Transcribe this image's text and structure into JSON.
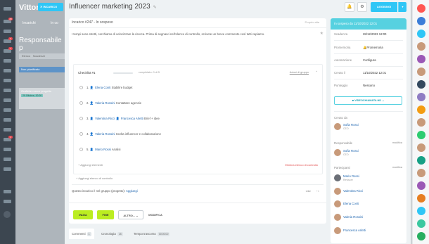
{
  "bg": {
    "brand": "Vittori",
    "tabs": [
      "Incarichi",
      "In co"
    ],
    "title": "Responsabile p",
    "bar_items": [
      "Elenco",
      "Scadenze"
    ],
    "column": "Non pianificato",
    "card_title": "Grafiche nuovo progetto",
    "card_tag": "29 Ottobre, 10:00",
    "close_label": "INCARICO",
    "sidebar_badges": [
      "28",
      "6",
      "1",
      "1"
    ]
  },
  "task": {
    "title": "Influencer marketing 2023",
    "header": "Incarico #247 - In sospeso",
    "copy_link": "Proprio alta",
    "description": "I tempi sono stretti, cerchiamo di velocizzare la ricerca. Prima di segnarvi nell'elenco di controllo, scrivete un breve commento così tutti capiamo.",
    "checklist": {
      "title": "Checklist #1",
      "completed": "completato: 0 di 5",
      "group_actions": "Azioni di gruppo",
      "items": [
        {
          "num": "1.",
          "user": "Elena Conti",
          "text": "Stabilire budget"
        },
        {
          "num": "2.",
          "user": "Valeria Rossini",
          "text": "Contattare agenzie"
        },
        {
          "num": "3.",
          "user": "Valentina Ricci",
          "user2": "Francesca Arletti",
          "text": "Brief + idee"
        },
        {
          "num": "4.",
          "user": "Valeria Rossini",
          "text": "Scelta influencer e collaborazione"
        },
        {
          "num": "5.",
          "user": "Mario Rossi",
          "text": "Analisi"
        }
      ],
      "add_items": "+ Aggiungi elementi",
      "delete": "Elimina elenco di controllo"
    },
    "add_checklist": "+ Aggiungi elenco di controllo",
    "project_text": "Questo incarico è nel gruppo (progetto):",
    "project_link": "Aggiungi",
    "like": "Like",
    "like_count": "+1",
    "buttons": {
      "start": "INIZIA",
      "finish": "FINE",
      "more": "ALTRO...",
      "edit": "MODIFICA"
    },
    "tabs": [
      {
        "label": "Commenti",
        "count": "1"
      },
      {
        "label": "Cronologia",
        "count": "15"
      },
      {
        "label": "Tempo trascorso",
        "count": "00:00:00"
      }
    ]
  },
  "toolbar": {
    "add_label": "AGGIUNGI",
    "bell": "🔔",
    "gear": "⚙",
    "dropdown": "▾"
  },
  "details": {
    "status": "In sospeso da 11/10/2022 12:01",
    "rows": [
      {
        "label": "Scadenza",
        "value": "28/12/2023 12:00"
      },
      {
        "label": "Promemoria",
        "value": "Promemoria"
      },
      {
        "label": "Automazione",
        "value": "Configura"
      },
      {
        "label": "Creato il",
        "value": "11/10/2022 12:01"
      },
      {
        "label": "Punteggio",
        "value": "Nessuno"
      }
    ],
    "video": "VIDEOCHIAMATA HD",
    "created_by": "Creato da",
    "creator": {
      "name": "Sofia Rossi",
      "role": "CEO"
    },
    "responsible": "Responsabile",
    "resp_modify": "modifica",
    "responsible_person": {
      "name": "Sofia Rossi",
      "role": "CEO"
    },
    "participants": "Partecipanti",
    "part_modify": "modifica",
    "participant_list": [
      {
        "name": "Mario Rossi",
        "role": "Revisore"
      },
      {
        "name": "Valentina Ricci",
        "role": ""
      },
      {
        "name": "Elena Conti",
        "role": ""
      },
      {
        "name": "Valeria Rossini",
        "role": ""
      },
      {
        "name": "Francesca Arletti",
        "role": ""
      }
    ]
  },
  "colors": {
    "accent": "#2fc6f6",
    "green": "#bbed21",
    "status": "#56d1e0",
    "link": "#2067b0"
  }
}
